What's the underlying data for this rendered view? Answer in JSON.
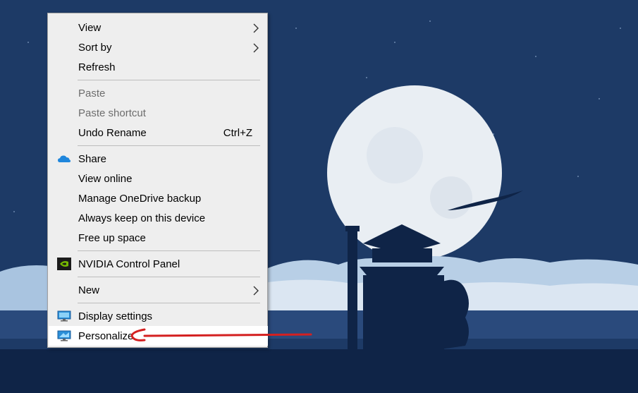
{
  "context_menu": {
    "items": [
      {
        "label": "View"
      },
      {
        "label": "Sort by"
      },
      {
        "label": "Refresh"
      },
      {
        "label": "Paste"
      },
      {
        "label": "Paste shortcut"
      },
      {
        "label": "Undo Rename",
        "shortcut": "Ctrl+Z"
      },
      {
        "label": "Share"
      },
      {
        "label": "View online"
      },
      {
        "label": "Manage OneDrive backup"
      },
      {
        "label": "Always keep on this device"
      },
      {
        "label": "Free up space"
      },
      {
        "label": "NVIDIA Control Panel"
      },
      {
        "label": "New"
      },
      {
        "label": "Display settings"
      },
      {
        "label": "Personalize"
      }
    ],
    "disabled_items": [
      "Paste",
      "Paste shortcut"
    ],
    "highlighted_item": "Personalize",
    "submenu_items": [
      "View",
      "Sort by",
      "New"
    ]
  },
  "annotation": {
    "type": "arrow",
    "target": "Personalize",
    "color": "#d42020"
  },
  "colors": {
    "sky": "#1d3a66",
    "moon": "#e9eef3",
    "clouds": "#a9c4e0",
    "silhouette": "#0f2447"
  }
}
